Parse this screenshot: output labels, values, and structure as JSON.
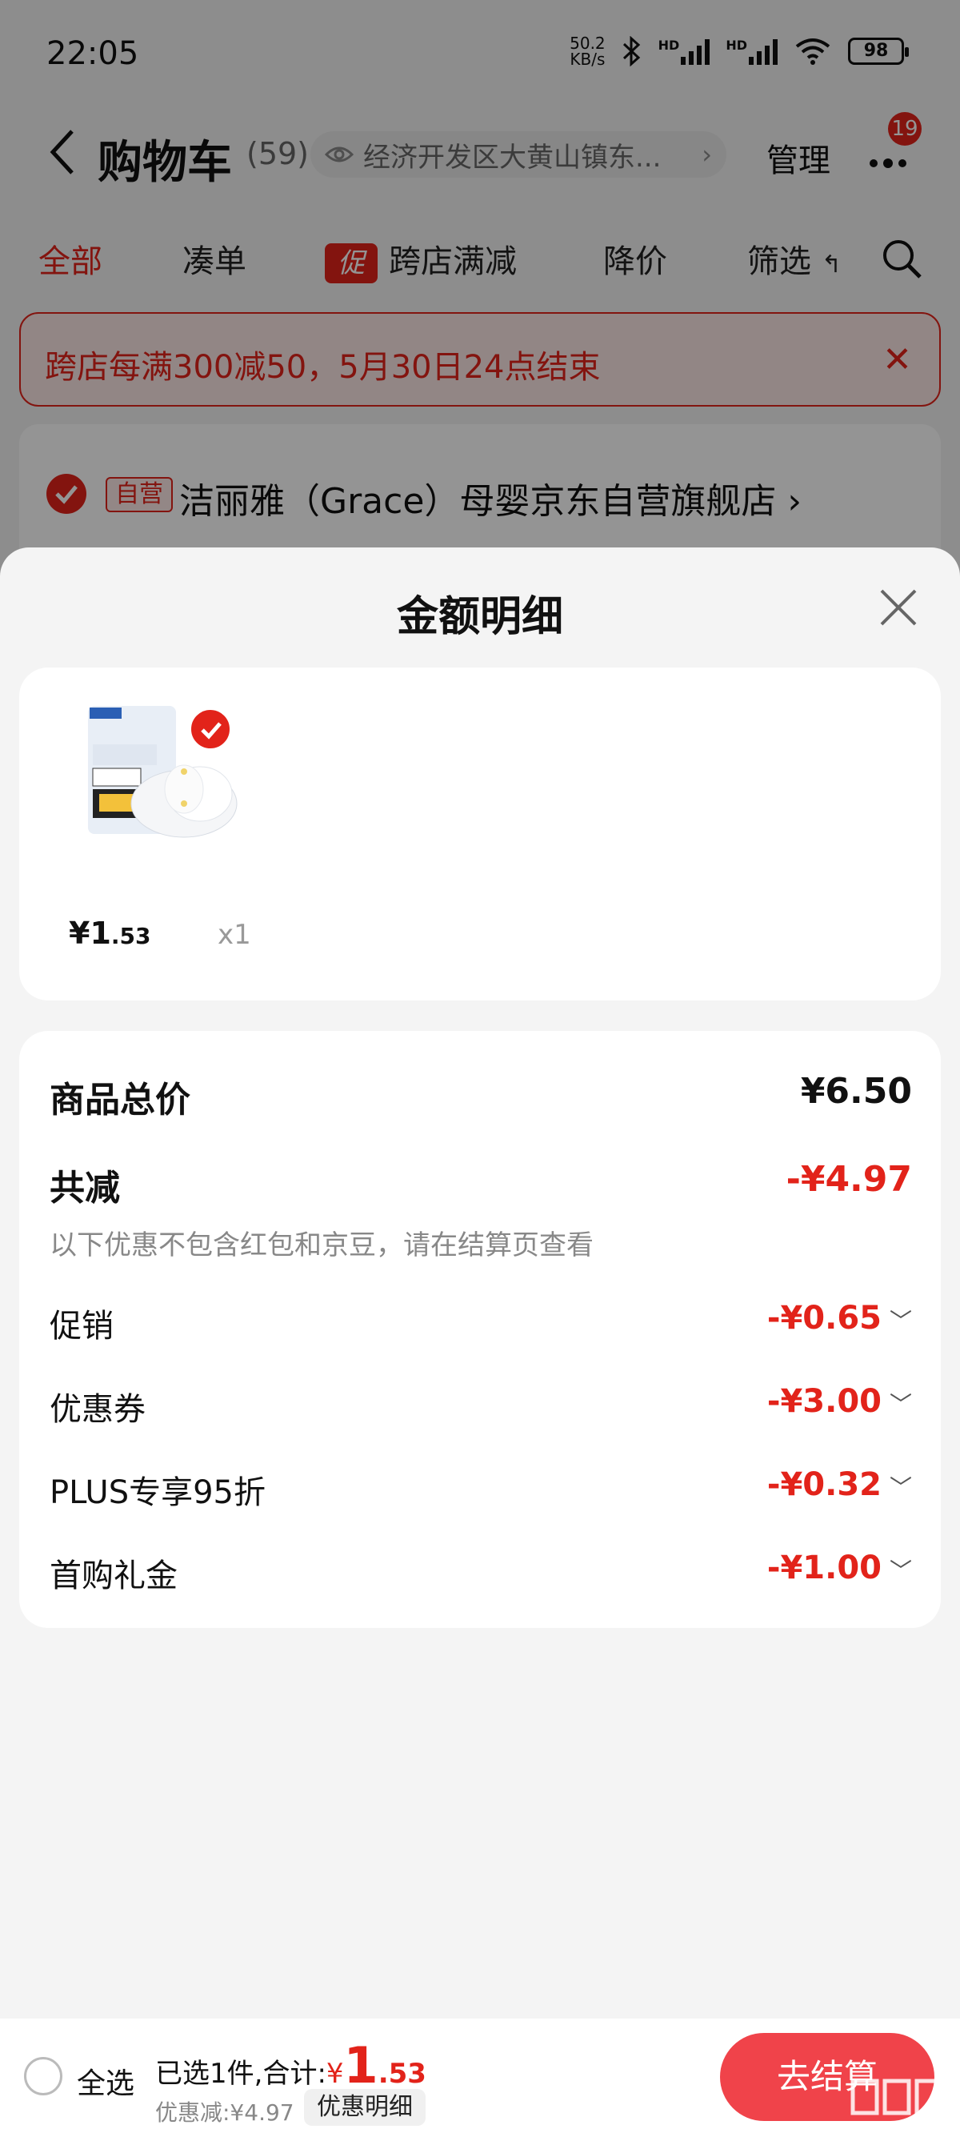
{
  "status_bar": {
    "time": "22:05",
    "net_speed_value": "50.2",
    "net_speed_unit": "KB/s",
    "signal_label_1": "HD",
    "signal_label_2": "HD",
    "battery": "98"
  },
  "nav": {
    "title": "购物车",
    "count": "(59)",
    "address": "经济开发区大黄山镇东...",
    "manage_label": "管理",
    "notification_badge": "19"
  },
  "tabs": {
    "all": "全部",
    "combine": "凑单",
    "promo_tag": "促",
    "cross_store": "跨店满减",
    "price_drop": "降价",
    "filter": "筛选"
  },
  "promo_banner": {
    "text": "跨店每满300减50，5月30日24点结束"
  },
  "store": {
    "self_tag": "自营",
    "name": "洁丽雅（Grace）母婴京东自营旗舰店"
  },
  "sheet": {
    "title": "金额明细",
    "product": {
      "price_symbol": "¥",
      "price_int": "1",
      "price_dec": ".53",
      "quantity": "x1"
    },
    "summary": {
      "total_label": "商品总价",
      "total_value": "¥6.50",
      "reduction_label": "共减",
      "reduction_value": "-¥4.97",
      "note": "以下优惠不包含红包和京豆，请在结算页查看",
      "items": [
        {
          "label": "促销",
          "value": "-¥0.65"
        },
        {
          "label": "优惠券",
          "value": "-¥3.00"
        },
        {
          "label": "PLUS专享95折",
          "value": "-¥0.32"
        },
        {
          "label": "首购礼金",
          "value": "-¥1.00"
        }
      ]
    }
  },
  "bottom_bar": {
    "select_all": "全选",
    "selected_text": "已选1件,合计:",
    "currency": "¥",
    "amount_int": "1",
    "amount_dec": ".53",
    "saved_text": "优惠减:¥4.97",
    "detail_button": "优惠明细",
    "checkout_button": "去结算"
  },
  "colors": {
    "accent": "#e2231a",
    "checkout": "#f0434a"
  }
}
